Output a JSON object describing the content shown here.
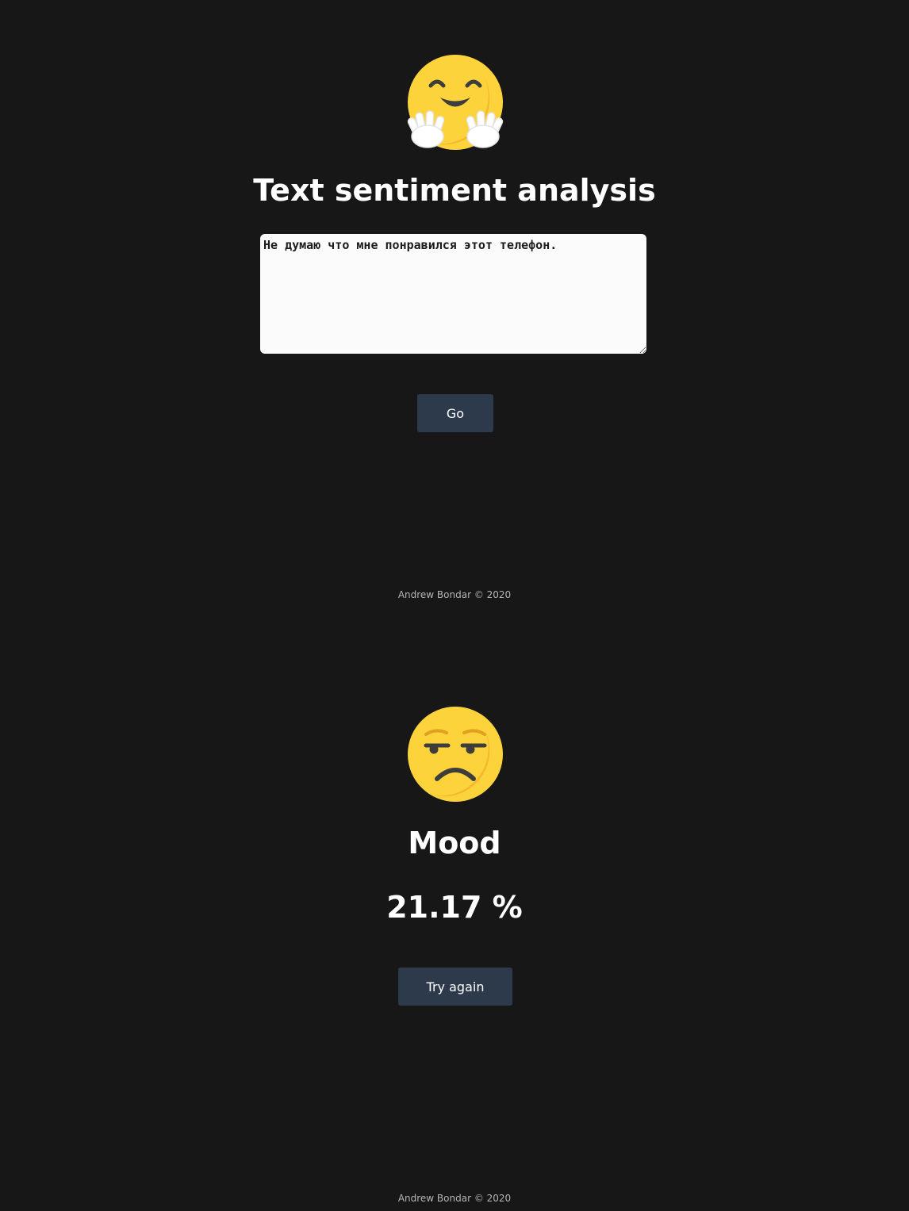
{
  "analyze_screen": {
    "emoji_icon": "hugging-face-icon",
    "title": "Text sentiment analysis",
    "input_text": "Не думаю что мне понравился этот телефон.",
    "go_label": "Go",
    "footer": "Andrew Bondar © 2020"
  },
  "result_screen": {
    "emoji_icon": "unamused-face-icon",
    "title": "Mood",
    "score": "21.17 %",
    "try_again_label": "Try again",
    "footer": "Andrew Bondar © 2020"
  },
  "colors": {
    "background": "#171717",
    "button": "#2d3a4b",
    "emoji_yellow": "#fdd33b",
    "text": "#ffffff"
  }
}
